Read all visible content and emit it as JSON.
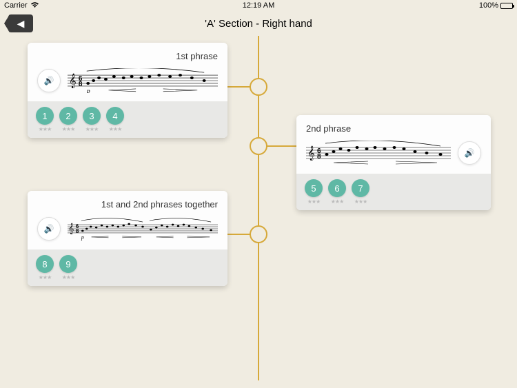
{
  "statusbar": {
    "carrier": "Carrier",
    "time": "12:19 AM",
    "battery": "100%"
  },
  "header": {
    "title": "'A' Section - Right hand"
  },
  "cards": [
    {
      "title": "1st phrase",
      "play_side": "left",
      "steps": [
        {
          "num": "1",
          "stars": "★★★"
        },
        {
          "num": "2",
          "stars": "★★★"
        },
        {
          "num": "3",
          "stars": "★★★"
        },
        {
          "num": "4",
          "stars": "★★★"
        }
      ]
    },
    {
      "title": "2nd phrase",
      "play_side": "right",
      "steps": [
        {
          "num": "5",
          "stars": "★★★"
        },
        {
          "num": "6",
          "stars": "★★★"
        },
        {
          "num": "7",
          "stars": "★★★"
        }
      ]
    },
    {
      "title": "1st and 2nd phrases together",
      "play_side": "left",
      "steps": [
        {
          "num": "8",
          "stars": "★★★"
        },
        {
          "num": "9",
          "stars": "★★★"
        }
      ]
    }
  ]
}
